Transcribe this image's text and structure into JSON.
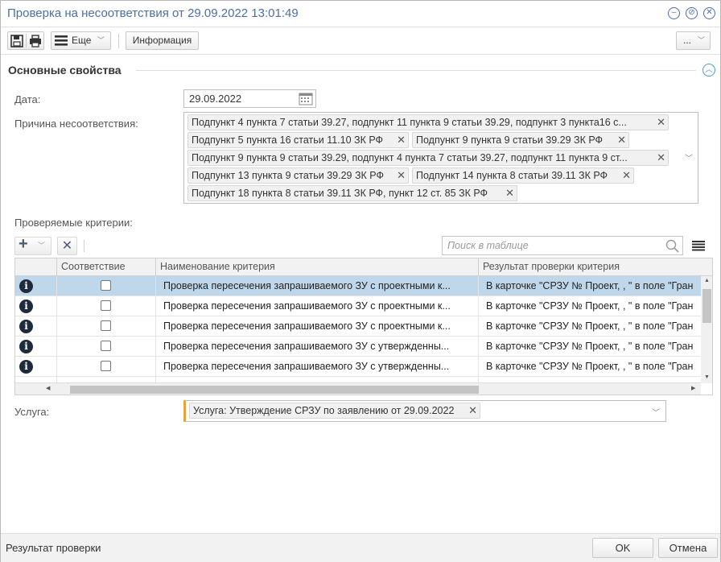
{
  "window": {
    "title": "Проверка на несоответствия от 29.09.2022 13:01:49"
  },
  "toolbar": {
    "more_label": "Еще",
    "info_label": "Информация",
    "overflow_label": "..."
  },
  "section": {
    "title": "Основные свойства"
  },
  "fields": {
    "date_label": "Дата:",
    "date_value": "29.09.2022",
    "reason_label": "Причина несоответствия:",
    "reasons": [
      "Подпункт 4 пункта 7 статьи 39.27, подпункт 11 пункта 9 статьи 39.29, подпункт 3 пункта16 с...",
      "Подпункт 5 пункта 16 статьи 11.10 ЗК РФ",
      "Подпункт 9 пункта 9 статьи 39.29 ЗК РФ",
      "Подпункт 9 пункта 9 статьи 39.29, подпункт 4 пункта 7 статьи 39.27, подпункт 11 пункта 9 ст...",
      "Подпункт 13 пункта 9 статьи 39.29 ЗК РФ",
      "Подпункт 14 пункта 8 статьи 39.11 ЗК РФ",
      "Подпункт 18 пункта 8 статьи 39.11 ЗК РФ, пункт 12 ст. 85 ЗК РФ"
    ],
    "criteria_label": "Проверяемые критерии:",
    "service_label": "Услуга:",
    "service_value": "Услуга: Утверждение СРЗУ по заявлению от 29.09.2022"
  },
  "grid": {
    "search_placeholder": "Поиск в таблице",
    "columns": [
      "Соответствие",
      "Наименование критерия",
      "Результат проверки критерия"
    ],
    "rows": [
      {
        "name": "Проверка пересечения запрашиваемого ЗУ с проектными к...",
        "result": "В карточке \"СРЗУ № Проект, , \" в поле \"Гран",
        "checked": false,
        "selected": true
      },
      {
        "name": "Проверка пересечения запрашиваемого ЗУ с проектными к...",
        "result": "В карточке \"СРЗУ № Проект, , \" в поле \"Гран",
        "checked": false,
        "selected": false
      },
      {
        "name": "Проверка пересечения запрашиваемого ЗУ с проектными к...",
        "result": "В карточке \"СРЗУ № Проект, , \" в поле \"Гран",
        "checked": false,
        "selected": false
      },
      {
        "name": "Проверка пересечения запрашиваемого ЗУ с утвержденны...",
        "result": "В карточке \"СРЗУ № Проект, , \" в поле \"Гран",
        "checked": false,
        "selected": false
      },
      {
        "name": "Проверка пересечения запрашиваемого ЗУ с утвержденны...",
        "result": "В карточке \"СРЗУ № Проект, , \" в поле \"Гран",
        "checked": false,
        "selected": false
      }
    ]
  },
  "footer": {
    "status": "Результат проверки",
    "ok_label": "OK",
    "cancel_label": "Отмена"
  },
  "colors": {
    "accent": "#4a6fa5",
    "selected_row": "#bfd7ea",
    "required_marker": "#e8a33c"
  }
}
